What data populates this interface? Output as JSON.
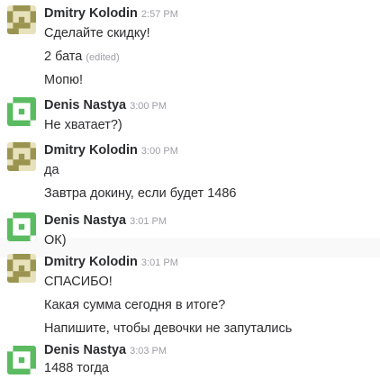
{
  "colors": {
    "dmitry_avatar_bg": "#e8e2bc",
    "dmitry_avatar_fg": "#9a9450",
    "denis_avatar_bg": "#5bbb61",
    "denis_avatar_fg": "#ffffff",
    "text": "#2c2d30",
    "timestamp": "#9e9ea6"
  },
  "avatars": {
    "dmitry_icon": "identicon-olive",
    "denis_icon": "identicon-green"
  },
  "messages": [
    {
      "author": "Dmitry Kolodin",
      "time": "2:57 PM",
      "lines": [
        {
          "text": "Сделайте скидку!"
        },
        {
          "text": "2 бата",
          "edited": "(edited)"
        },
        {
          "text": "Мопю!"
        }
      ]
    },
    {
      "author": "Denis Nastya",
      "time": "3:00 PM",
      "lines": [
        {
          "text": "Не хватает?)"
        }
      ]
    },
    {
      "author": "Dmitry Kolodin",
      "time": "3:00 PM",
      "lines": [
        {
          "text": "да"
        },
        {
          "text": "Завтра докину, если будет 1486"
        }
      ]
    },
    {
      "author": "Denis Nastya",
      "time": "3:01 PM",
      "lines": [
        {
          "text": "ОК)"
        }
      ]
    },
    {
      "author": "Dmitry Kolodin",
      "time": "3:01 PM",
      "lines": [
        {
          "text": "СПАСИБО!"
        },
        {
          "text": "Какая сумма сегодня в итоге?"
        },
        {
          "text": "Напишите, чтобы девочки не запутались"
        }
      ]
    },
    {
      "author": "Denis Nastya",
      "time": "3:03 PM",
      "lines": [
        {
          "text": "1488 тогда"
        }
      ]
    }
  ]
}
